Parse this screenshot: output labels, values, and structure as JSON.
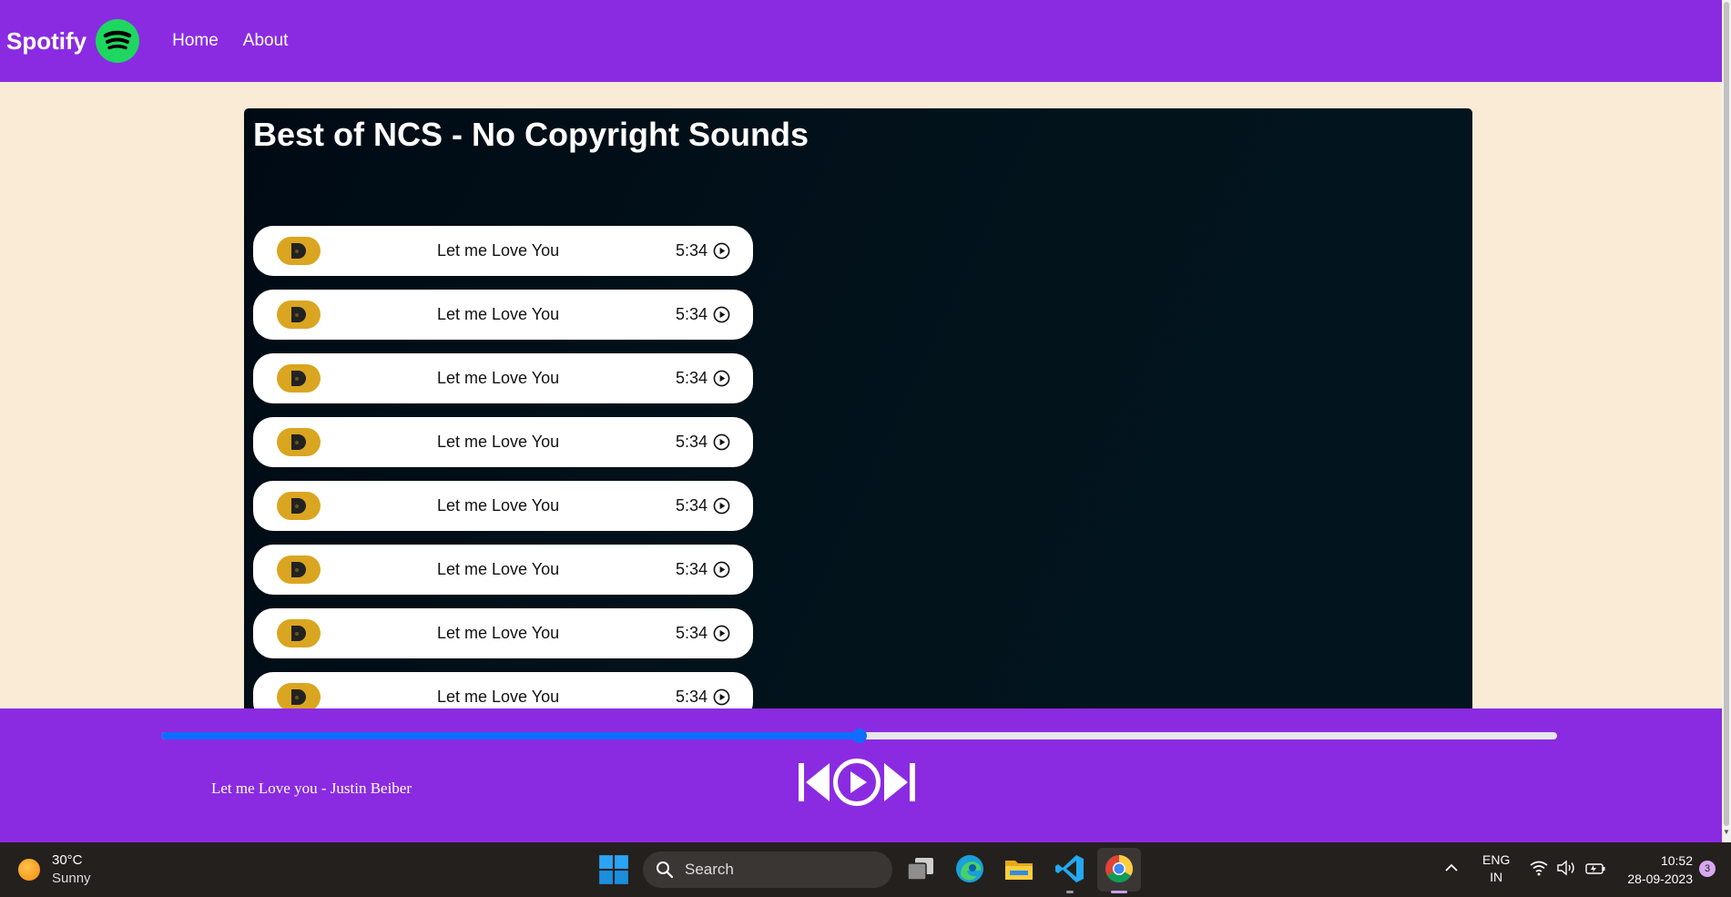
{
  "navbar": {
    "brand": "Spotify",
    "links": [
      "Home",
      "About"
    ]
  },
  "playlist": {
    "title": "Best of NCS - No Copyright Sounds",
    "songs": [
      {
        "name": "Let me Love You",
        "duration": "5:34"
      },
      {
        "name": "Let me Love You",
        "duration": "5:34"
      },
      {
        "name": "Let me Love You",
        "duration": "5:34"
      },
      {
        "name": "Let me Love You",
        "duration": "5:34"
      },
      {
        "name": "Let me Love You",
        "duration": "5:34"
      },
      {
        "name": "Let me Love You",
        "duration": "5:34"
      },
      {
        "name": "Let me Love You",
        "duration": "5:34"
      },
      {
        "name": "Let me Love You",
        "duration": "5:34"
      }
    ]
  },
  "player": {
    "now_playing": "Let me Love you - Justin Beiber",
    "progress_fraction": 0.5,
    "controls": [
      "previous-icon",
      "play-icon",
      "next-icon"
    ]
  },
  "taskbar": {
    "weather_temp": "30°C",
    "weather_cond": "Sunny",
    "search_placeholder": "Search",
    "lang_line1": "ENG",
    "lang_line2": "IN",
    "time": "10:52",
    "date": "28-09-2023",
    "notification_count": "3",
    "apps": [
      "windows-start-icon",
      "task-view-icon",
      "edge-icon",
      "file-explorer-icon",
      "vscode-icon",
      "chrome-icon"
    ]
  },
  "colors": {
    "nav_background": "#8a2be2",
    "page_background": "#faebd7",
    "accent": "#0d6efd",
    "cover": "#daa520",
    "spotify_green": "#1ed760"
  }
}
